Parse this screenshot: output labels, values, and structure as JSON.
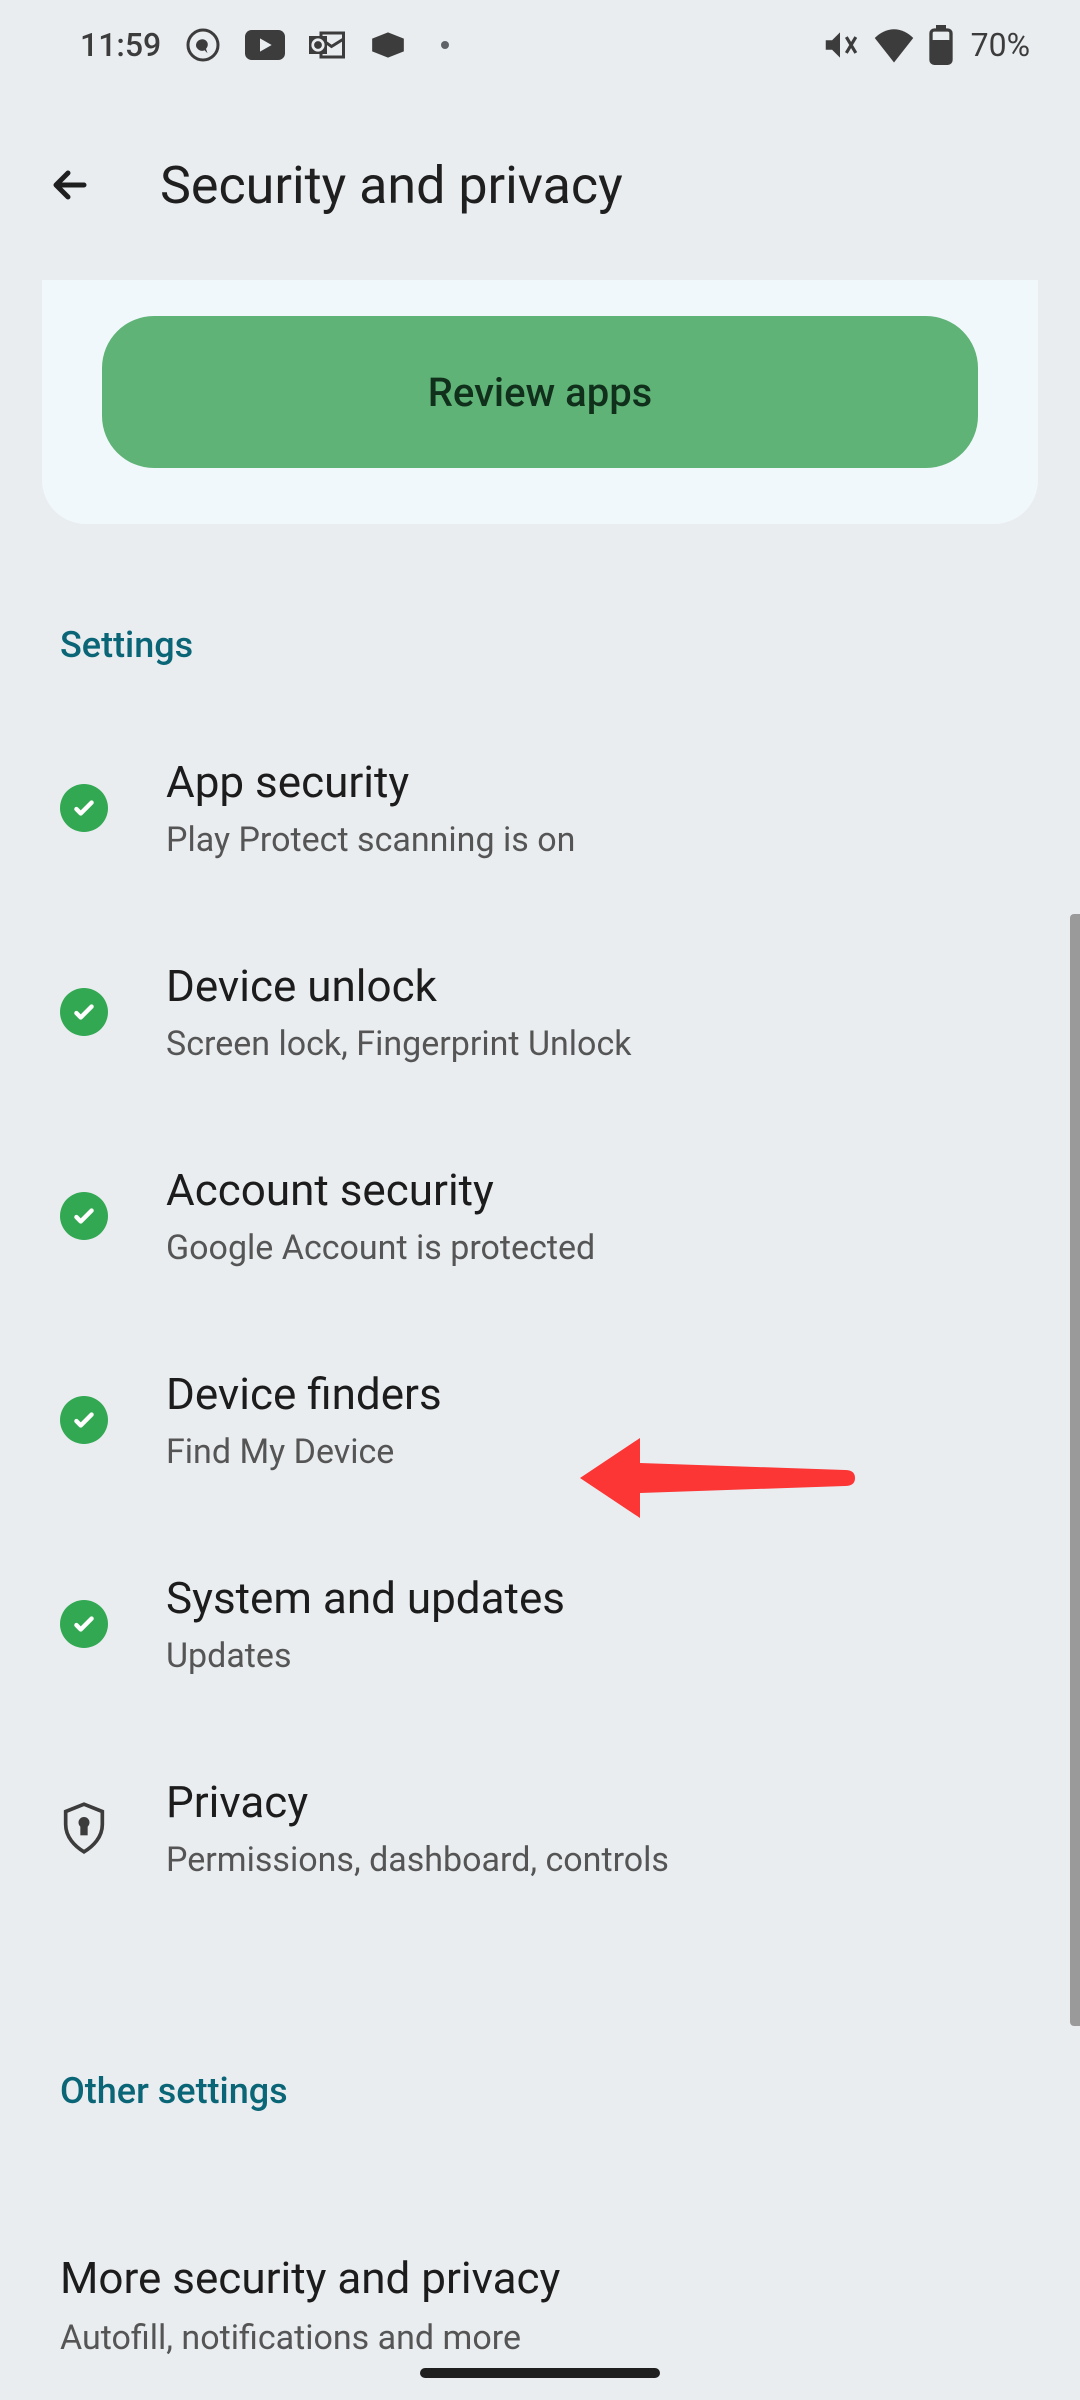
{
  "status": {
    "time": "11:59",
    "battery": "70%"
  },
  "header": {
    "title": "Security and privacy"
  },
  "card": {
    "button_label": "Review apps"
  },
  "sections": {
    "settings_label": "Settings",
    "other_label": "Other settings"
  },
  "items": {
    "app_security": {
      "title": "App security",
      "sub": "Play Protect scanning is on"
    },
    "device_unlock": {
      "title": "Device unlock",
      "sub": "Screen lock, Fingerprint Unlock"
    },
    "account_security": {
      "title": "Account security",
      "sub": "Google Account is protected"
    },
    "device_finders": {
      "title": "Device finders",
      "sub": "Find My Device"
    },
    "system_updates": {
      "title": "System and updates",
      "sub": "Updates"
    },
    "privacy": {
      "title": "Privacy",
      "sub": "Permissions, dashboard, controls"
    }
  },
  "more": {
    "title": "More security and privacy",
    "sub": "Autofill, notifications and more"
  }
}
